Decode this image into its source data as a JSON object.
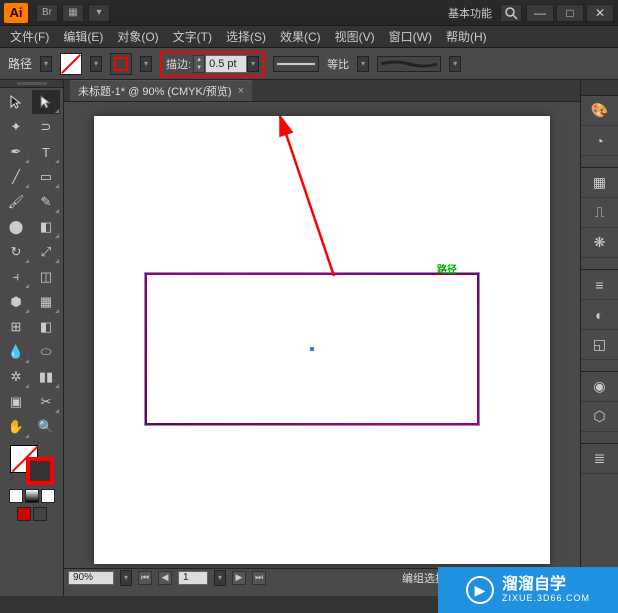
{
  "app": {
    "logo": "Ai",
    "workspace_label": "基本功能"
  },
  "menu": {
    "file": "文件(F)",
    "edit": "编辑(E)",
    "object": "对象(O)",
    "text": "文字(T)",
    "select": "选择(S)",
    "effect": "效果(C)",
    "view": "视图(V)",
    "window": "窗口(W)",
    "help": "帮助(H)"
  },
  "control": {
    "type_label": "路径",
    "stroke_label": "描边:",
    "stroke_value": "0.5 pt",
    "profile_label": "等比",
    "brush_style": "charcoal"
  },
  "document": {
    "tab_title": "未标题-1* @ 90% (CMYK/预览)",
    "rect_label": "路径"
  },
  "status": {
    "zoom": "90%",
    "page": "1",
    "mode": "编组选择"
  },
  "watermark": {
    "title": "溜溜自学",
    "sub": "ZIXUE.3D66.COM"
  },
  "icons": {
    "search": "search-icon",
    "close": "×",
    "min": "—",
    "max": "□",
    "dropdown": "▾",
    "left": "◀",
    "right": "▶",
    "play": "▶"
  }
}
